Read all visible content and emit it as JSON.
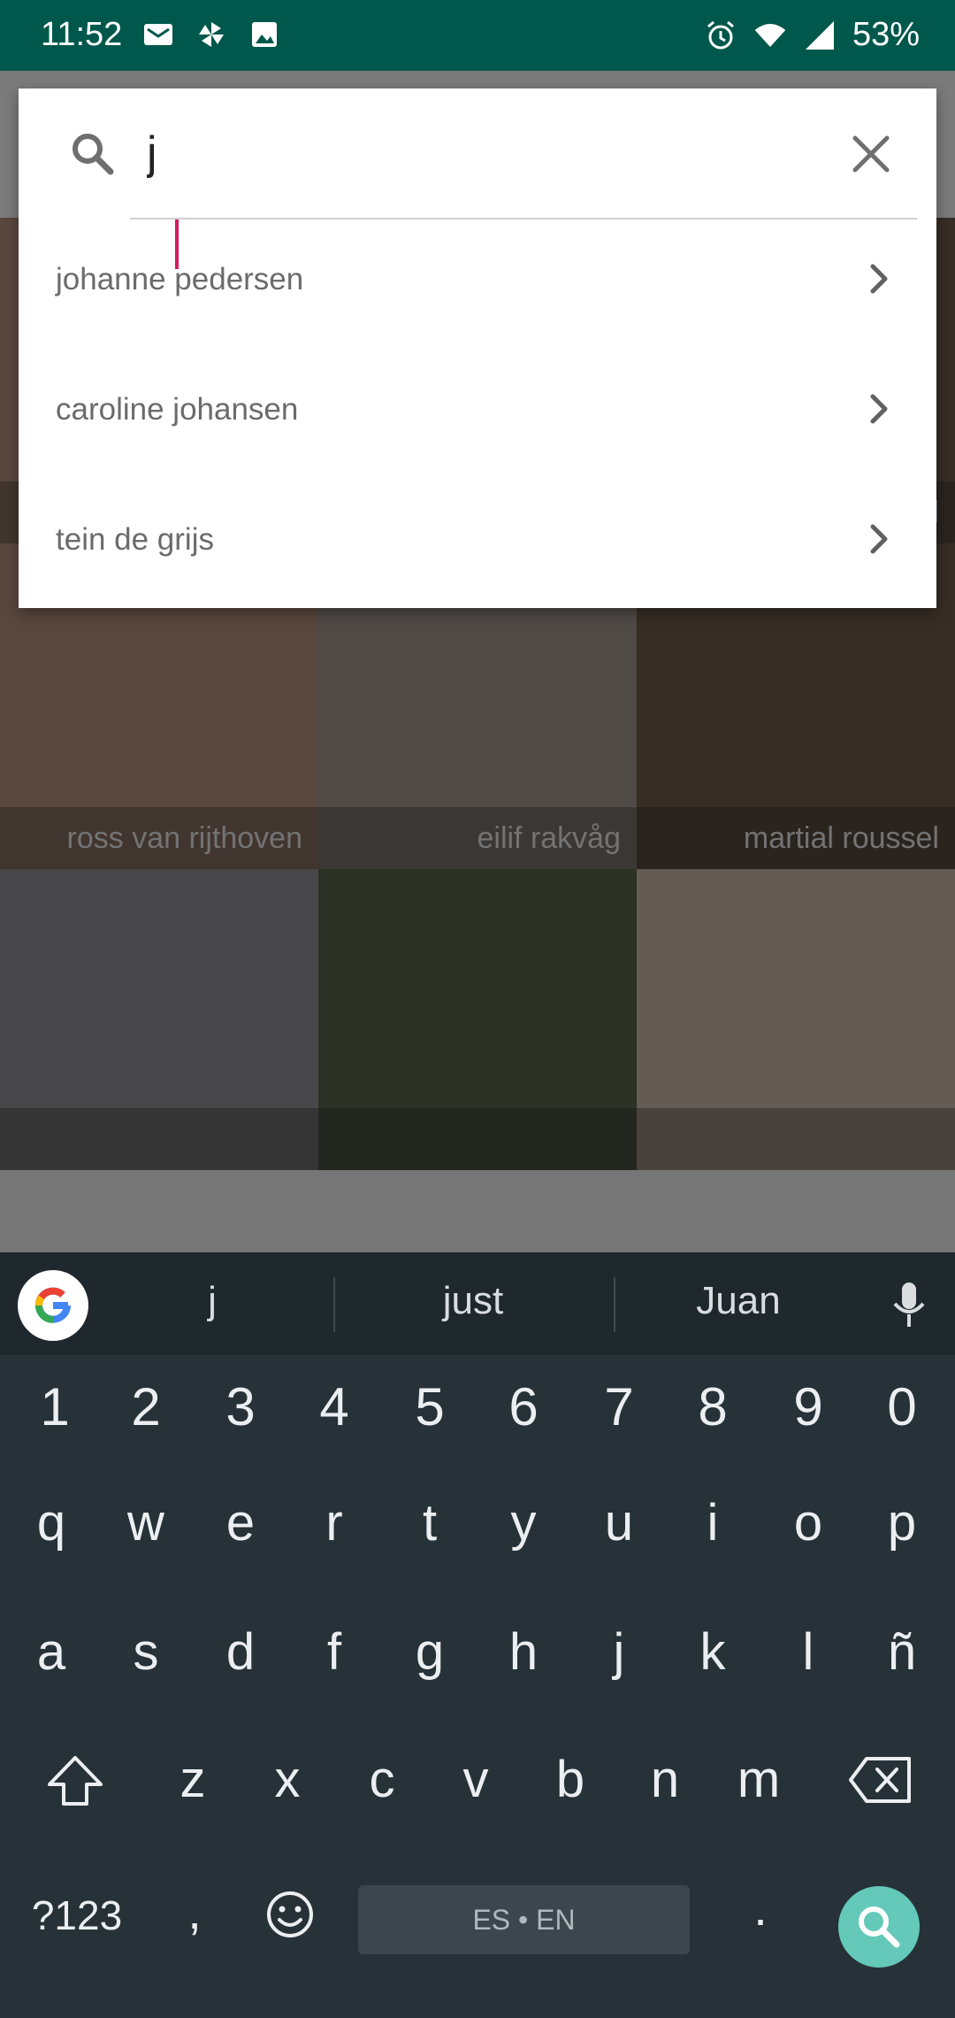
{
  "status_bar": {
    "time": "11:52",
    "battery": "53%",
    "left_icons": [
      "gmail-icon",
      "pinwheel-icon",
      "image-icon"
    ],
    "right_icons": [
      "alarm-icon",
      "wifi-icon",
      "signal-icon"
    ]
  },
  "search": {
    "query": "j",
    "suggestions": [
      {
        "label": "johanne pedersen"
      },
      {
        "label": "caroline johansen"
      },
      {
        "label": "tein de grijs"
      }
    ]
  },
  "grid": {
    "tiles": [
      {
        "name": "ross van rijthoven",
        "color": "#b38f7d"
      },
      {
        "name": "eilif rakvåg",
        "color": "#9e948c"
      },
      {
        "name": "martial roussel",
        "color": "#6c5a4a"
      },
      {
        "name": "",
        "color": "#8f8f92"
      },
      {
        "name": "",
        "color": "#59634b"
      },
      {
        "name": "",
        "color": "#c9b6a6"
      }
    ]
  },
  "keyboard": {
    "suggestions": [
      "j",
      "just",
      "Juan"
    ],
    "row_numbers": [
      "1",
      "2",
      "3",
      "4",
      "5",
      "6",
      "7",
      "8",
      "9",
      "0"
    ],
    "row1": [
      "q",
      "w",
      "e",
      "r",
      "t",
      "y",
      "u",
      "i",
      "o",
      "p"
    ],
    "row2": [
      "a",
      "s",
      "d",
      "f",
      "g",
      "h",
      "j",
      "k",
      "l",
      "ñ"
    ],
    "row3": [
      "z",
      "x",
      "c",
      "v",
      "b",
      "n",
      "m"
    ],
    "symbols_key": "?123",
    "comma_key": ",",
    "period_key": ".",
    "space_label": "ES • EN",
    "accent_color": "#64c9b8"
  }
}
